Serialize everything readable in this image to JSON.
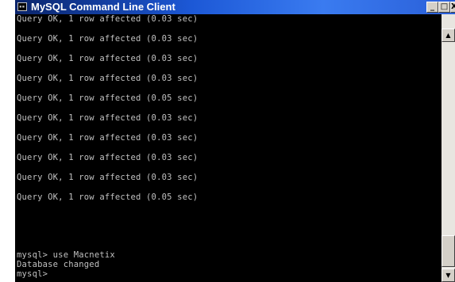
{
  "window": {
    "title": "MySQL Command Line Client",
    "icon": "console-icon",
    "buttons": {
      "minimize": "_",
      "maximize": "□",
      "close": "X"
    }
  },
  "console": {
    "lines": [
      "Query OK, 1 row affected (0.03 sec)",
      "Query OK, 1 row affected (0.03 sec)",
      "Query OK, 1 row affected (0.03 sec)",
      "Query OK, 1 row affected (0.03 sec)",
      "Query OK, 1 row affected (0.05 sec)",
      "Query OK, 1 row affected (0.03 sec)",
      "Query OK, 1 row affected (0.03 sec)",
      "Query OK, 1 row affected (0.03 sec)",
      "Query OK, 1 row affected (0.03 sec)",
      "Query OK, 1 row affected (0.05 sec)",
      "mysql> use Macnetix",
      "Database changed",
      "mysql>"
    ],
    "text_color": "#c0c0c0",
    "background": "#000000"
  },
  "scrollbar": {
    "up_arrow": "▲",
    "down_arrow": "▼"
  }
}
